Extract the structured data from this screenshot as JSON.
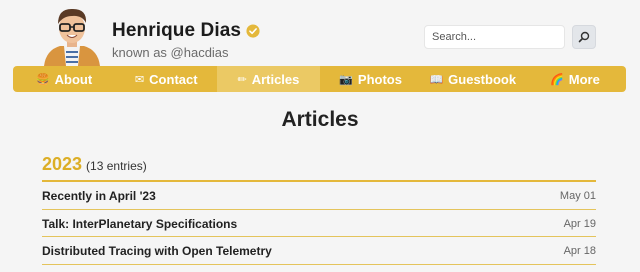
{
  "profile": {
    "name": "Henrique Dias",
    "known_as": "known as @hacdias"
  },
  "search": {
    "placeholder": "Search..."
  },
  "nav": {
    "items": [
      {
        "emoji": "🍔",
        "label": "About"
      },
      {
        "emoji": "✉",
        "label": "Contact"
      },
      {
        "emoji": "✏",
        "label": "Articles"
      },
      {
        "emoji": "📷",
        "label": "Photos"
      },
      {
        "emoji": "📖",
        "label": "Guestbook"
      },
      {
        "emoji": "🌈",
        "label": "More"
      }
    ],
    "active": "Articles"
  },
  "page": {
    "title": "Articles"
  },
  "year_group": {
    "year": "2023",
    "entries": "(13 entries)"
  },
  "articles": [
    {
      "title": "Recently in April '23",
      "date": "May 01"
    },
    {
      "title": "Talk: InterPlanetary Specifications",
      "date": "Apr 19"
    },
    {
      "title": "Distributed Tracing with Open Telemetry",
      "date": "Apr 18"
    }
  ],
  "colors": {
    "accent": "#e4b83b",
    "nav_active": "#ebc964",
    "year": "#dcae26",
    "background": "#f5f5f5"
  }
}
